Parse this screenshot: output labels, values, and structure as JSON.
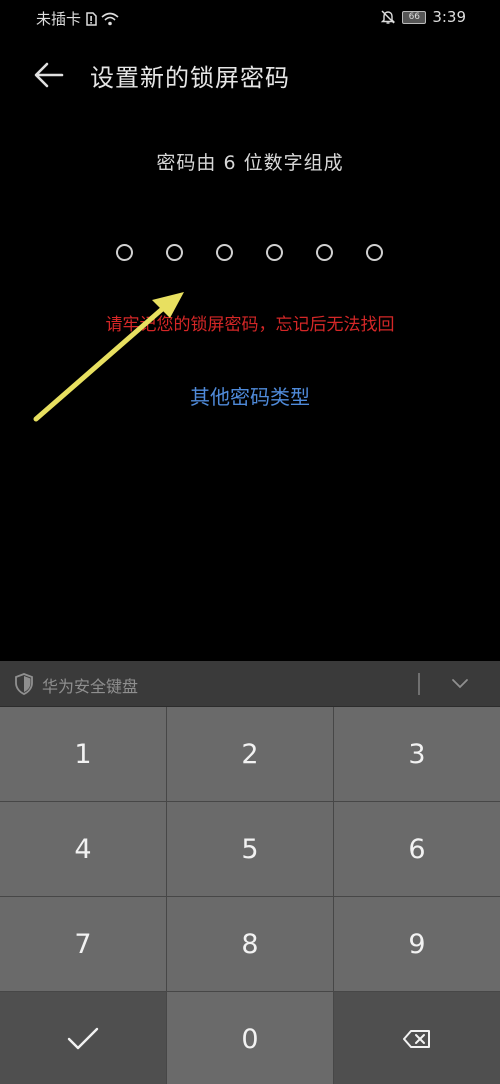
{
  "status": {
    "carrier": "未插卡",
    "battery": "66",
    "time": "3:39"
  },
  "header": {
    "title": "设置新的锁屏密码"
  },
  "pin": {
    "subtitle": "密码由 6 位数字组成",
    "length": 6,
    "warning": "请牢记您的锁屏密码，忘记后无法找回",
    "other_types": "其他密码类型"
  },
  "keyboard": {
    "name": "华为安全键盘",
    "keys": [
      "1",
      "2",
      "3",
      "4",
      "5",
      "6",
      "7",
      "8",
      "9",
      "0"
    ]
  },
  "colors": {
    "warning": "#d42727",
    "link": "#4f8ad9",
    "annotation": "#e8e060"
  }
}
